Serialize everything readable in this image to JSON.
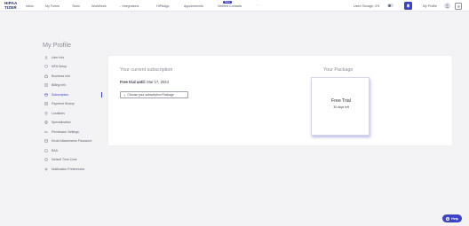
{
  "brand": {
    "line1": "HIPAA",
    "line2": "TIZE",
    "line2_suffix": "R"
  },
  "nav": [
    {
      "label": "Inbox",
      "chevron": false
    },
    {
      "label": "My Forms",
      "chevron": false
    },
    {
      "label": "Team",
      "chevron": false
    },
    {
      "label": "Workflows",
      "chevron": false
    },
    {
      "label": "Integrations",
      "chevron": true
    },
    {
      "label": "HIPAAgo",
      "chevron": false
    },
    {
      "label": "Appointments",
      "chevron": false
    },
    {
      "label": "Verified Contacts",
      "chevron": false
    }
  ],
  "beta_badge": "Beta",
  "more": "···",
  "storage_label": "Used Storage: 0%",
  "profile_label": "My Profile",
  "page_title": "My Profile",
  "sidebar": [
    {
      "label": "User Info",
      "icon": "user-icon"
    },
    {
      "label": "MFA Setup",
      "icon": "shield-icon"
    },
    {
      "label": "Business Info",
      "icon": "briefcase-icon"
    },
    {
      "label": "Billing Info",
      "icon": "receipt-icon"
    },
    {
      "label": "Subscription",
      "icon": "card-icon",
      "active": true
    },
    {
      "label": "Payment History",
      "icon": "history-icon"
    },
    {
      "label": "Locations",
      "icon": "location-icon"
    },
    {
      "label": "Specialization",
      "icon": "globe-icon"
    },
    {
      "label": "Permission Settings",
      "icon": "key-icon"
    },
    {
      "label": "Email Attachments Password",
      "icon": "mail-icon"
    },
    {
      "label": "BAA",
      "icon": "document-icon"
    },
    {
      "label": "Default Time Zone",
      "icon": "clock-icon"
    },
    {
      "label": "Notification Preferences",
      "icon": "gear-icon"
    }
  ],
  "subscription": {
    "current_title": "Your current subscription",
    "trial_label": "Free trial until:",
    "trial_date": "Mar 17, 2024",
    "choose_button": "Choose your subscription Package"
  },
  "package": {
    "title": "Your Package",
    "name": "Free Trial",
    "days_left": "30 days left"
  },
  "help_label": "Help",
  "colors": {
    "accent": "#3b43c9",
    "background": "#f3f3f5",
    "brand_dark": "#1f2a5a"
  }
}
